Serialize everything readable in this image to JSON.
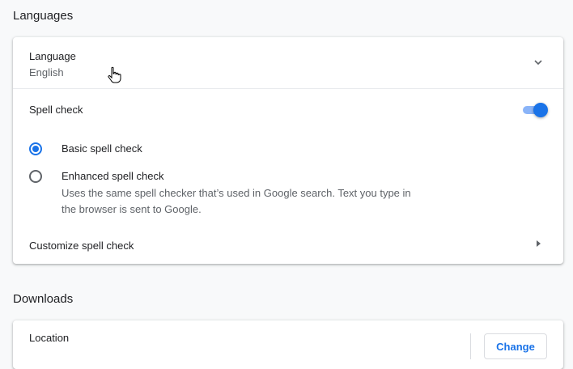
{
  "languages": {
    "section_title": "Languages",
    "language_label": "Language",
    "language_value": "English",
    "spell_check_label": "Spell check",
    "spell_check_enabled": true,
    "basic_label": "Basic spell check",
    "basic_selected": true,
    "enhanced_label": "Enhanced spell check",
    "enhanced_description": "Uses the same spell checker that’s used in Google search. Text you type in the browser is sent to Google.",
    "customize_label": "Customize spell check"
  },
  "downloads": {
    "section_title": "Downloads",
    "location_label": "Location",
    "change_button": "Change"
  },
  "colors": {
    "accent": "#1a73e8",
    "toggle_track": "#8ab4f8",
    "background": "#f8f9fa"
  }
}
